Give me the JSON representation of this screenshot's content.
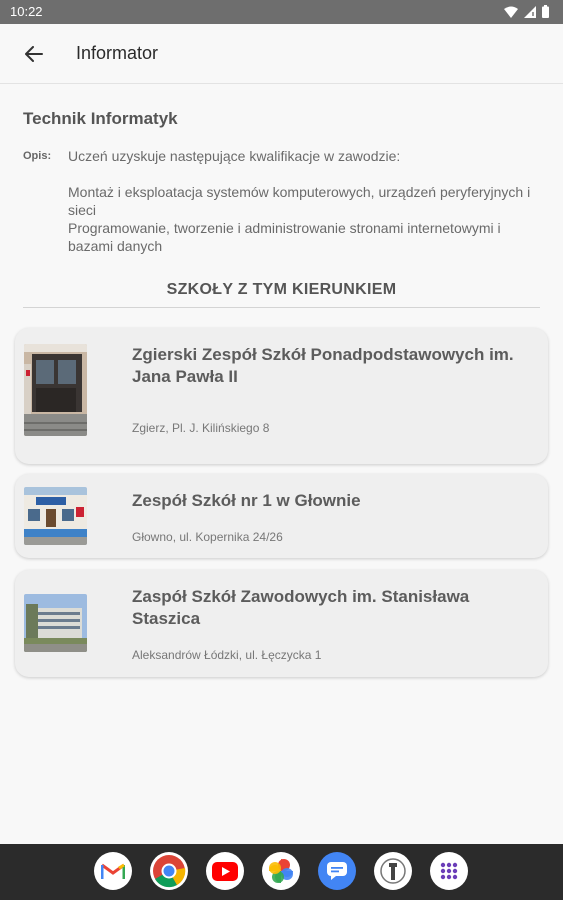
{
  "status_bar": {
    "time": "10:22"
  },
  "app_bar": {
    "title": "Informator"
  },
  "course": {
    "title": "Technik Informatyk",
    "description_label": "Opis:",
    "description": "Uczeń uzyskuje następujące kwalifikacje w zawodzie:\n\nMontaż i eksploatacja systemów komputerowych, urządzeń peryferyjnych i sieci\nProgramowanie, tworzenie i administrowanie stronami internetowymi i bazami danych"
  },
  "schools_section": {
    "header": "SZKOŁY Z TYM KIERUNKIEM",
    "schools": [
      {
        "name": "Zgierski Zespół Szkół Ponadpodstawowych im. Jana Pawła II",
        "address": "Zgierz, Pl. J. Kilińskiego 8"
      },
      {
        "name": "Zespół Szkół nr 1 w Głownie",
        "address": "Głowno, ul. Kopernika 24/26"
      },
      {
        "name": "Zaspół Szkół Zawodowych im. Stanisława Staszica",
        "address": "Aleksandrów Łódzki, ul. Łęczycka 1"
      }
    ]
  },
  "dock": {
    "apps": [
      "gmail-icon",
      "chrome-icon",
      "youtube-icon",
      "photos-icon",
      "messages-icon",
      "files-icon",
      "app-drawer-icon"
    ]
  },
  "colors": {
    "status_bar": "#6e6e6e",
    "background": "#f8f8f8",
    "card": "#efefef",
    "nav_bar": "#2b2b2b"
  }
}
